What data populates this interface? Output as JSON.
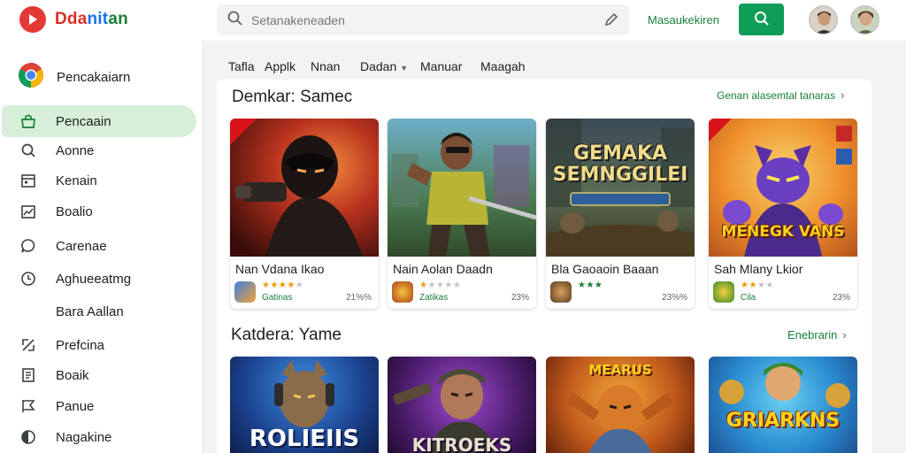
{
  "app": {
    "brand_parts": [
      "Dda",
      "nit",
      "an"
    ]
  },
  "search": {
    "placeholder": "Setanakeneaden"
  },
  "header": {
    "link_label": "Masaukekiren"
  },
  "sidebar": {
    "top_label": "Pencakaiarn",
    "items": [
      {
        "label": "Pencaain",
        "icon": "store-icon",
        "active": true
      },
      {
        "label": "Aonne",
        "icon": "search-icon",
        "active": false
      },
      {
        "label": "Kenain",
        "icon": "calendar-icon",
        "active": false
      },
      {
        "label": "Boalio",
        "icon": "chart-icon",
        "active": false
      },
      {
        "label": "Carenae",
        "icon": "chat-icon",
        "active": false
      },
      {
        "label": "Aghueeatmg",
        "icon": "clock-icon",
        "active": false
      },
      {
        "label": "Bara Aallan",
        "icon": "",
        "active": false
      },
      {
        "label": "Prefcina",
        "icon": "tag-icon",
        "active": false
      },
      {
        "label": "Boaik",
        "icon": "document-icon",
        "active": false
      },
      {
        "label": "Panue",
        "icon": "flag-icon",
        "active": false
      },
      {
        "label": "Nagakine",
        "icon": "shield-icon",
        "active": false
      }
    ]
  },
  "tabs": [
    {
      "label": "Tafla"
    },
    {
      "label": "Applk"
    },
    {
      "label": "Nnan"
    },
    {
      "label": "Dadan"
    },
    {
      "label": "Manuar"
    },
    {
      "label": "Maagah"
    }
  ],
  "sections": [
    {
      "title": "Demkar: Samec",
      "link": "Genan alasemtal tanaras",
      "cards": [
        {
          "name": "Nan Vdana Ikao",
          "subtitle": "Gatinas",
          "price": "21%%",
          "rating": 4,
          "art_text": ""
        },
        {
          "name": "Nain Aolan Daadn",
          "subtitle": "Zatikas",
          "price": "23%",
          "rating": 1,
          "art_text": ""
        },
        {
          "name": "Bla Gaoaoin Baaan",
          "subtitle": "",
          "price": "23%%",
          "rating": 3,
          "art_text": "GEMAKA SEMNGGILEI"
        },
        {
          "name": "Sah Mlany Lkior",
          "subtitle": "Cila",
          "price": "23%",
          "rating": 2,
          "art_text": "MENEGK VANS"
        }
      ]
    },
    {
      "title": "Katdera: Yame",
      "link": "Enebrarin",
      "cards": [
        {
          "art_text": "ROLIEIIS"
        },
        {
          "art_text": "KITROEKS"
        },
        {
          "art_text": "MEARUS"
        },
        {
          "art_text": "GRIARKNS"
        }
      ]
    }
  ],
  "colors": {
    "accent": "#0f9d58",
    "active_bg": "#d7efd9",
    "link": "#188038",
    "star": "#f29900"
  }
}
